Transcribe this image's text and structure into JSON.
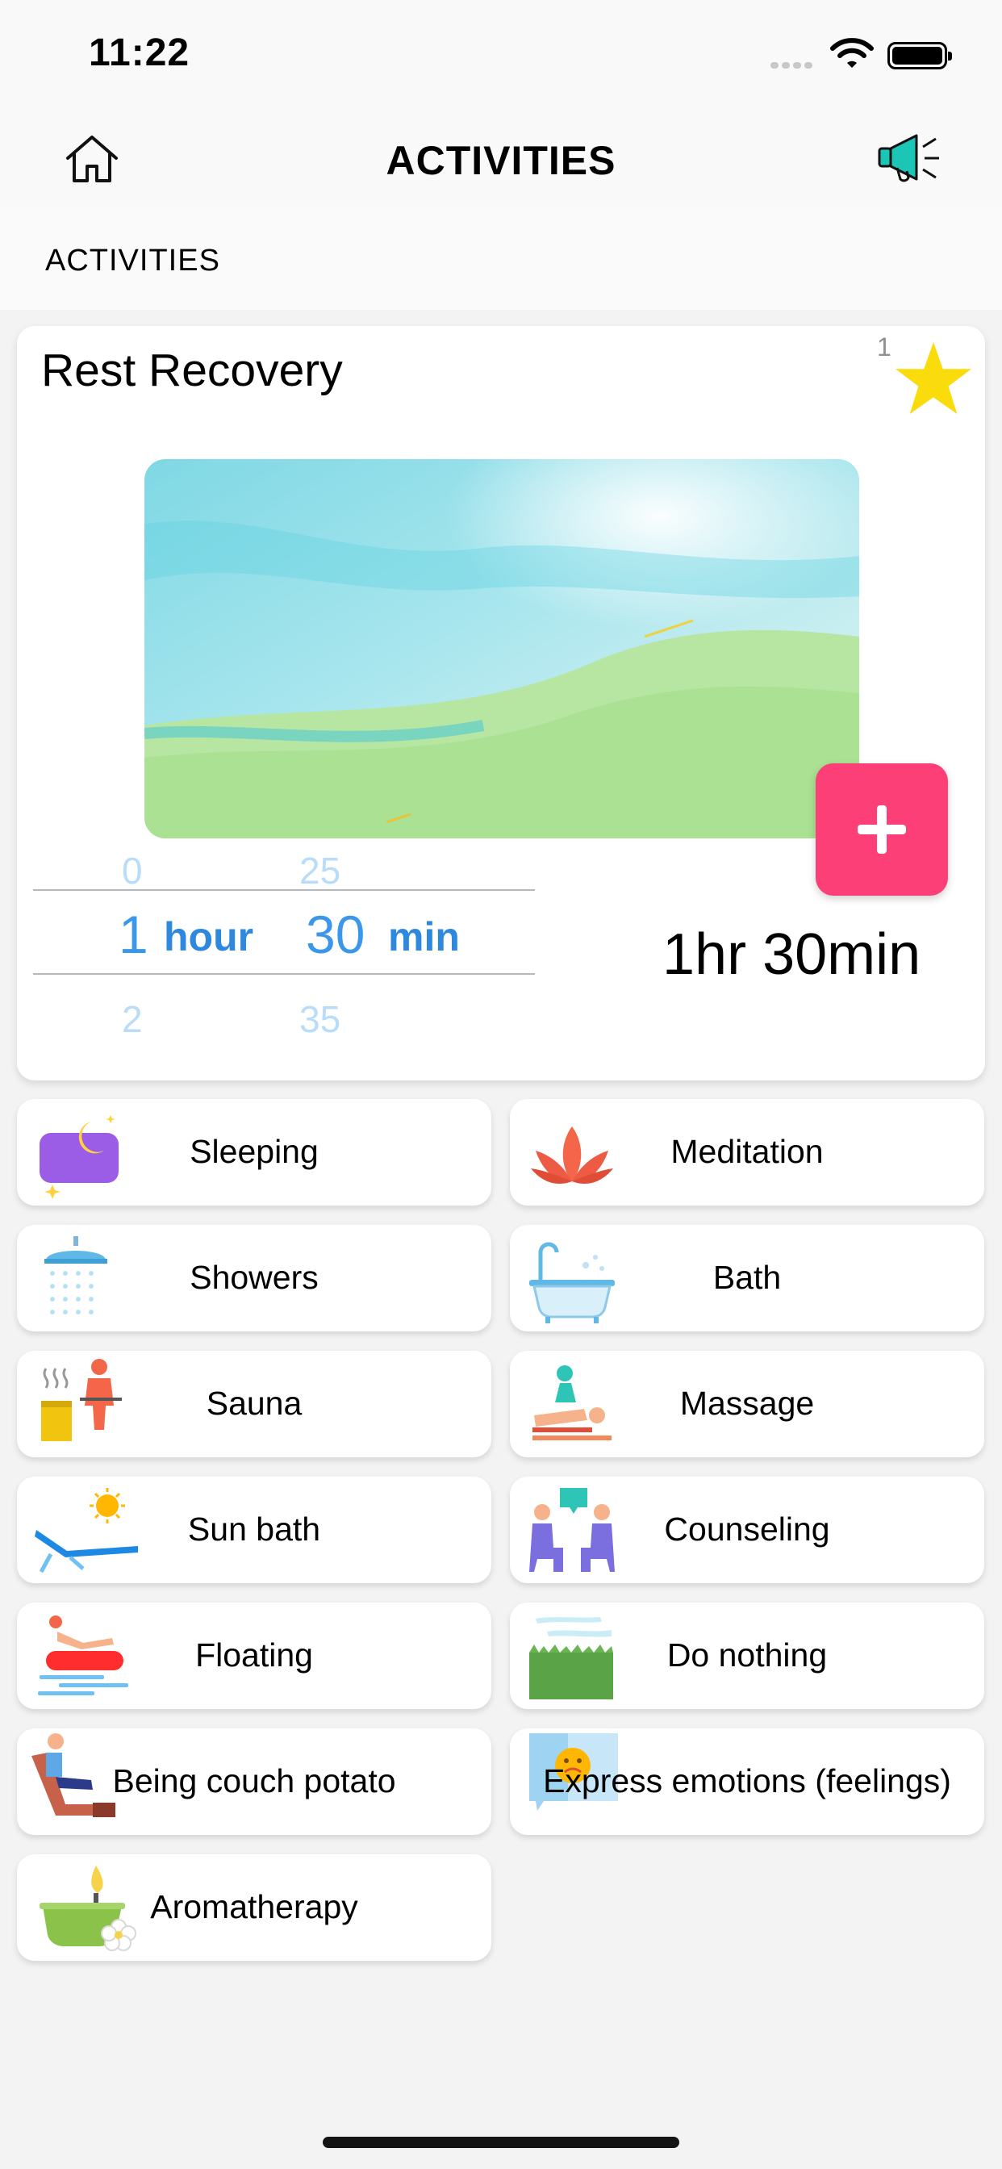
{
  "status_bar": {
    "time": "11:22"
  },
  "nav": {
    "title": "ACTIVITIES",
    "home_icon": "home-icon",
    "announce_icon": "megaphone-icon"
  },
  "section": {
    "label": "ACTIVITIES"
  },
  "card": {
    "title": "Rest Recovery",
    "favorite_count": "1",
    "duration_text": "1hr 30min",
    "picker": {
      "hours_prev": "0",
      "hours_selected": "1",
      "hours_next": "2",
      "hours_unit": "hour",
      "minutes_prev": "25",
      "minutes_selected": "30",
      "minutes_next": "35",
      "minutes_unit": "min"
    },
    "accent": "#fc3f76"
  },
  "activities": [
    {
      "label": "Sleeping",
      "icon": "pillow-moon-icon"
    },
    {
      "label": "Meditation",
      "icon": "lotus-icon"
    },
    {
      "label": "Showers",
      "icon": "shower-icon"
    },
    {
      "label": "Bath",
      "icon": "bathtub-icon"
    },
    {
      "label": "Sauna",
      "icon": "sauna-icon"
    },
    {
      "label": "Massage",
      "icon": "massage-icon"
    },
    {
      "label": "Sun bath",
      "icon": "sunbed-icon"
    },
    {
      "label": "Counseling",
      "icon": "counseling-icon"
    },
    {
      "label": "Floating",
      "icon": "floating-icon"
    },
    {
      "label": "Do nothing",
      "icon": "grass-icon"
    },
    {
      "label": "Being couch potato",
      "icon": "couch-icon"
    },
    {
      "label": "Express emotions (feelings)",
      "icon": "emotions-icon"
    },
    {
      "label": "Aromatherapy",
      "icon": "aroma-candle-icon"
    }
  ]
}
